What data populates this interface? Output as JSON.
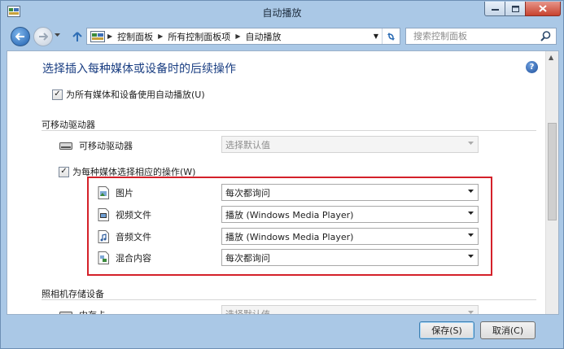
{
  "window": {
    "title": "自动播放"
  },
  "navigation": {
    "breadcrumbs": [
      "控制面板",
      "所有控制面板项",
      "自动播放"
    ],
    "search_placeholder": "搜索控制面板"
  },
  "content": {
    "heading": "选择插入每种媒体或设备时的后续操作",
    "use_autoplay_all": {
      "label": "为所有媒体和设备使用自动播放(U)",
      "checked": true
    },
    "removable_section": {
      "title": "可移动驱动器",
      "device": {
        "label": "可移动驱动器",
        "value": "选择默认值",
        "disabled": true
      },
      "per_media": {
        "label": "为每种媒体选择相应的操作(W)",
        "checked": true
      },
      "media": [
        {
          "label": "图片",
          "value": "每次都询问",
          "icon": "picture-icon"
        },
        {
          "label": "视频文件",
          "value": "播放 (Windows Media Player)",
          "icon": "video-file-icon"
        },
        {
          "label": "音频文件",
          "value": "播放 (Windows Media Player)",
          "icon": "audio-file-icon"
        },
        {
          "label": "混合内容",
          "value": "每次都询问",
          "icon": "mixed-content-icon"
        }
      ]
    },
    "camera_section": {
      "title": "照相机存储设备",
      "device": {
        "label": "内存卡",
        "value": "选择默认值"
      }
    }
  },
  "footer": {
    "save_label": "保存(S)",
    "cancel_label": "取消(C)"
  },
  "colors": {
    "heading": "#1a3e82",
    "highlight": "#d4212a",
    "chrome": "#aac8e6"
  }
}
